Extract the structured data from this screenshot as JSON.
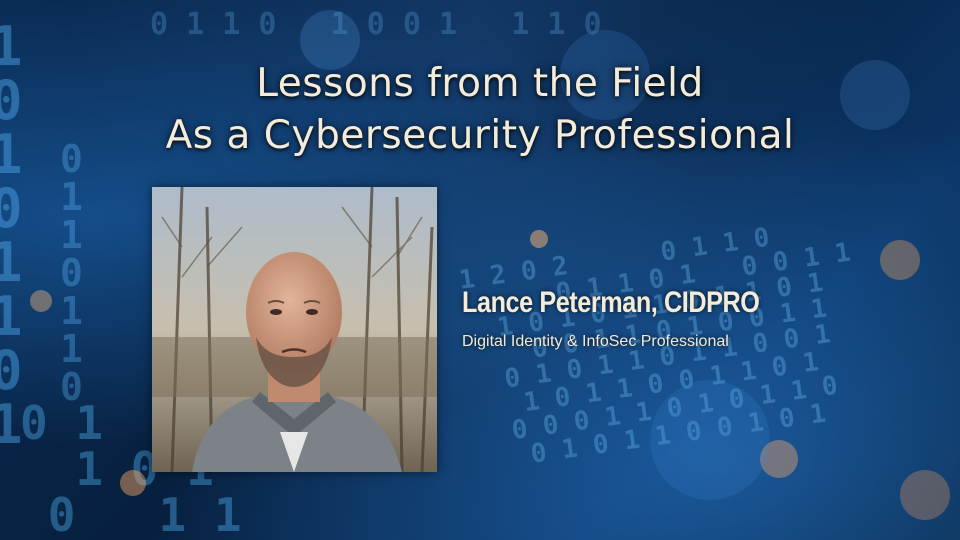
{
  "slide": {
    "title_line1": "Lessons from the Field",
    "title_line2": "As a Cybersecurity Professional",
    "speaker_name": "Lance Peterman, CIDPRO",
    "speaker_title": "Digital Identity & InfoSec Professional"
  },
  "colors": {
    "background": "#061a33",
    "title_text": "#f4ecd9",
    "accent_blue": "#3a9ad9"
  }
}
